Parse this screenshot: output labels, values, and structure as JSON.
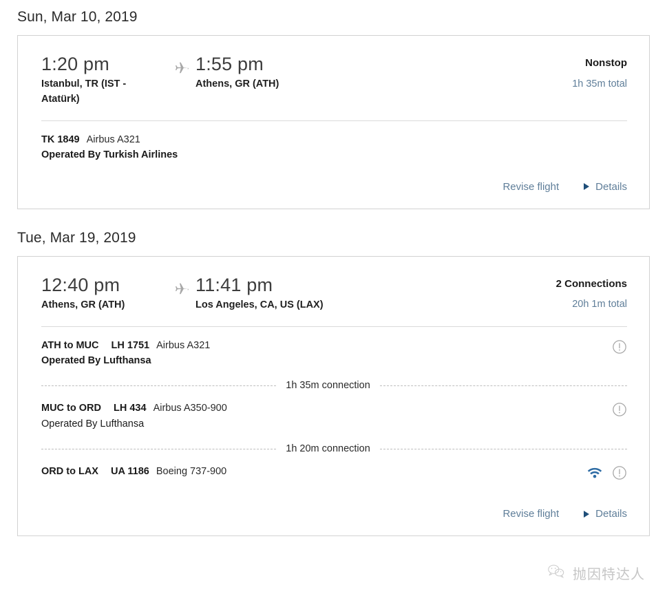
{
  "itinerary": {
    "flights": [
      {
        "date_heading": "Sun, Mar 10, 2019",
        "depart_time": "1:20 pm",
        "depart_place": "Istanbul, TR (IST - Atatürk)",
        "arrive_time": "1:55 pm",
        "arrive_place": "Athens, GR (ATH)",
        "stops_label": "Nonstop",
        "duration_label": "1h 35m total",
        "segments": [
          {
            "route": "",
            "flight_number": "TK 1849",
            "equipment": "Airbus A321",
            "operated_by": "Operated By Turkish Airlines",
            "operated_bold": true,
            "has_wifi": false,
            "has_alert": false
          }
        ],
        "connections": [],
        "revise_label": "Revise flight",
        "details_label": "Details"
      },
      {
        "date_heading": "Tue, Mar 19, 2019",
        "depart_time": "12:40 pm",
        "depart_place": "Athens, GR (ATH)",
        "arrive_time": "11:41 pm",
        "arrive_place": "Los Angeles, CA, US (LAX)",
        "stops_label": "2 Connections",
        "duration_label": "20h 1m total",
        "segments": [
          {
            "route": "ATH to MUC",
            "flight_number": "LH 1751",
            "equipment": "Airbus A321",
            "operated_by": "Operated By Lufthansa",
            "operated_bold": true,
            "has_wifi": false,
            "has_alert": true
          },
          {
            "route": "MUC to ORD",
            "flight_number": "LH 434",
            "equipment": "Airbus A350-900",
            "operated_by": "Operated By Lufthansa",
            "operated_bold": false,
            "has_wifi": false,
            "has_alert": true
          },
          {
            "route": "ORD to LAX",
            "flight_number": "UA 1186",
            "equipment": "Boeing 737-900",
            "operated_by": "",
            "operated_bold": false,
            "has_wifi": true,
            "has_alert": true
          }
        ],
        "connections": [
          "1h 35m connection",
          "1h 20m connection"
        ],
        "revise_label": "Revise flight",
        "details_label": "Details"
      }
    ]
  },
  "watermark": {
    "text": "抛因特达人",
    "icon": "wechat-icon"
  },
  "colors": {
    "link": "#5f7e99",
    "duration": "#5f7e99",
    "wifi": "#2e6ca4",
    "alert": "#a6a6a6",
    "triangle": "#1f4e79",
    "card_border": "#d2d2d2"
  }
}
